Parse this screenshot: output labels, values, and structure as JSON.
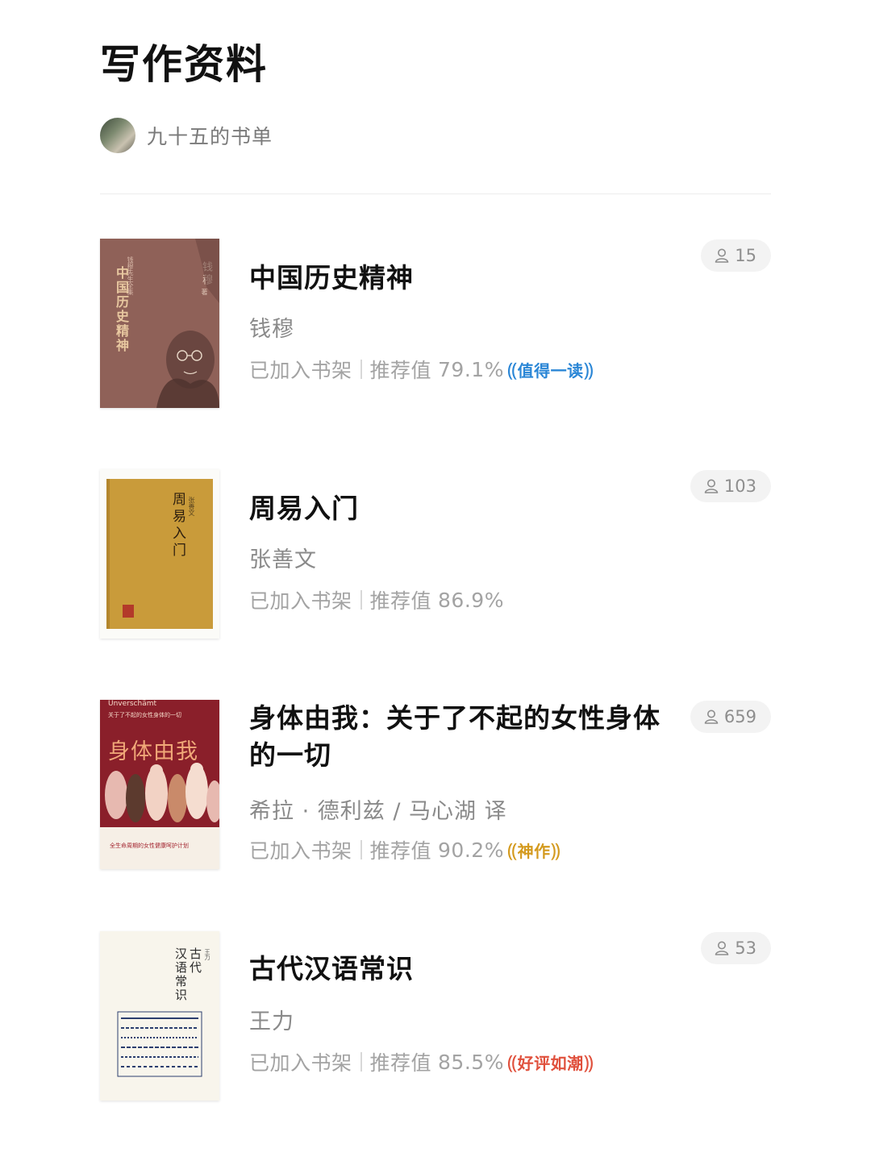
{
  "page": {
    "title": "写作资料"
  },
  "owner": {
    "name": "九十五的书单"
  },
  "books": [
    {
      "title": "中国历史精神",
      "author": "钱穆",
      "status": "已加入书架",
      "rating_label": "推荐值",
      "rating": "79.1%",
      "badge": {
        "text": "值得一读",
        "color": "#2a86d6"
      },
      "readers": "15",
      "cover": {
        "color": "#8f6158",
        "vertical_title": "中国历史精神",
        "author_text": "钱穆",
        "author_suffix": "著",
        "series_text": "钱穆先生全集"
      }
    },
    {
      "title": "周易入门",
      "author": "张善文",
      "status": "已加入书架",
      "rating_label": "推荐值",
      "rating": "86.9%",
      "badge": null,
      "readers": "103",
      "cover": {
        "color": "#c99b3a",
        "vertical_title": "周易入门",
        "author_text": "张善文"
      }
    },
    {
      "title": "身体由我：关于了不起的女性身体的一切",
      "author": "希拉 · 德利兹 / 马心湖 译",
      "status": "已加入书架",
      "rating_label": "推荐值",
      "rating": "90.2%",
      "badge": {
        "text": "神作",
        "color": "#d49a1e"
      },
      "readers": "659",
      "cover": {
        "color": "#8a1f2a",
        "en_title": "Unverschämt",
        "subtitle": "关于了不起的女性身体的一切",
        "big_title": "身体由我",
        "tagline": "全生命周期的女性健康呵护计划"
      }
    },
    {
      "title": "古代汉语常识",
      "author": "王力",
      "status": "已加入书架",
      "rating_label": "推荐值",
      "rating": "85.5%",
      "badge": {
        "text": "好评如潮",
        "color": "#e0503c"
      },
      "readers": "53",
      "cover": {
        "color": "#f8f5ec",
        "vertical_title_1": "古代",
        "vertical_title_2": "汉语常识",
        "author_text": "王力"
      }
    }
  ]
}
